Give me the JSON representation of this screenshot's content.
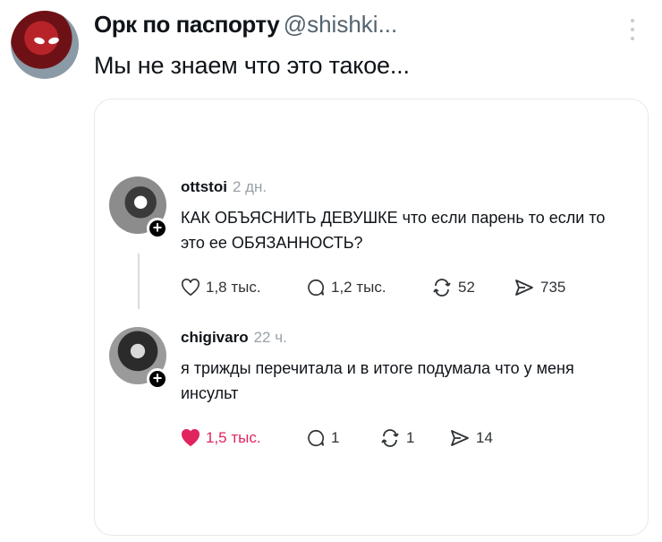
{
  "tweet": {
    "author_name": "Орк по паспорту",
    "author_handle": "@shishki...",
    "text": "Мы не знаем что это такое..."
  },
  "embedded": {
    "posts": [
      {
        "username": "ottstoi",
        "time": "2 дн.",
        "text": "КАК ОБЪЯСНИТЬ ДЕВУШКЕ что если парень то если то это ее ОБЯЗАННОСТЬ?",
        "likes": "1,8 тыс.",
        "replies": "1,2 тыс.",
        "reposts": "52",
        "shares": "735",
        "liked": false
      },
      {
        "username": "chigivaro",
        "time": "22 ч.",
        "text": "я трижды перечитала и в итоге подумала что у меня инсульт",
        "likes": "1,5 тыс.",
        "replies": "1",
        "reposts": "1",
        "shares": "14",
        "liked": true
      }
    ]
  },
  "icons": {
    "more": "more-vertical-icon",
    "like": "heart-icon",
    "reply": "comment-icon",
    "repost": "repost-icon",
    "share": "send-icon",
    "follow": "plus-icon"
  },
  "colors": {
    "like_active": "#e0245e",
    "muted": "#536471"
  }
}
